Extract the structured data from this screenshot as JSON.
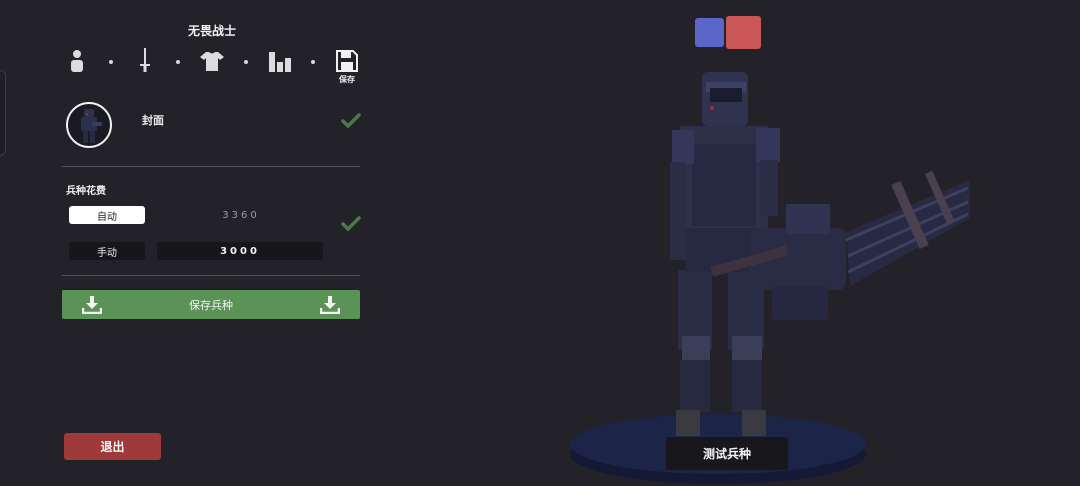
{
  "unit": {
    "name": "无畏战士"
  },
  "toolbar": {
    "items": [
      "person-icon",
      "sword-icon",
      "shirt-icon",
      "bars-icon"
    ],
    "save_label": "保存"
  },
  "cover": {
    "label": "封面",
    "checked": true
  },
  "cost": {
    "title": "兵种花费",
    "auto_label": "自动",
    "auto_value": "3360",
    "manual_label": "手动",
    "manual_value": "3000",
    "checked": true
  },
  "actions": {
    "save_unit_label": "保存兵种",
    "exit_label": "退出",
    "test_unit_label": "测试兵种"
  },
  "team": {
    "blue": "#5a66c8",
    "red": "#c95757"
  },
  "colors": {
    "accent_green": "#5a9355",
    "exit_red": "#9e3a3a",
    "background": "#232228"
  }
}
